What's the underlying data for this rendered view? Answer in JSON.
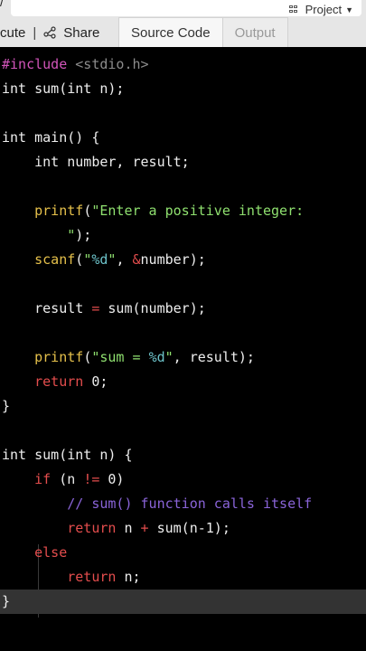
{
  "top": {
    "corner_glyph": "/",
    "project_label": "Project"
  },
  "toolbar": {
    "execute_label": "cute",
    "separator": "|",
    "share_label": "Share"
  },
  "tabs": [
    {
      "label": "Source Code",
      "active": true
    },
    {
      "label": "Output",
      "active": false
    }
  ],
  "code_lines": [
    [
      [
        "pp",
        "#include "
      ],
      [
        "hd",
        "<stdio.h>"
      ]
    ],
    [
      [
        "txt",
        "int sum(int n);"
      ]
    ],
    [],
    [
      [
        "txt",
        "int main() {"
      ]
    ],
    [
      [
        "txt",
        "    int number, result;"
      ]
    ],
    [],
    [
      [
        "txt",
        "    "
      ],
      [
        "fn",
        "printf"
      ],
      [
        "txt",
        "("
      ],
      [
        "str",
        "\"Enter a positive integer:"
      ]
    ],
    [
      [
        "str",
        "        \""
      ],
      [
        "txt",
        ");"
      ]
    ],
    [
      [
        "txt",
        "    "
      ],
      [
        "fn",
        "scanf"
      ],
      [
        "txt",
        "("
      ],
      [
        "str",
        "\""
      ],
      [
        "fmt",
        "%d"
      ],
      [
        "str",
        "\""
      ],
      [
        "txt",
        ", "
      ],
      [
        "op",
        "&"
      ],
      [
        "txt",
        "number);"
      ]
    ],
    [],
    [
      [
        "txt",
        "    result "
      ],
      [
        "op",
        "="
      ],
      [
        "txt",
        " sum(number);"
      ]
    ],
    [],
    [
      [
        "txt",
        "    "
      ],
      [
        "fn",
        "printf"
      ],
      [
        "txt",
        "("
      ],
      [
        "str",
        "\"sum = "
      ],
      [
        "fmt",
        "%d"
      ],
      [
        "str",
        "\""
      ],
      [
        "txt",
        ", result);"
      ]
    ],
    [
      [
        "txt",
        "    "
      ],
      [
        "kw",
        "return"
      ],
      [
        "txt",
        " 0;"
      ]
    ],
    [
      [
        "txt",
        "}"
      ]
    ],
    [],
    [
      [
        "txt",
        "int sum(int n) {"
      ]
    ],
    [
      [
        "txt",
        "    "
      ],
      [
        "kw",
        "if"
      ],
      [
        "txt",
        " (n "
      ],
      [
        "op",
        "!="
      ],
      [
        "txt",
        " 0)"
      ]
    ],
    [
      [
        "txt",
        "        "
      ],
      [
        "cm",
        "// sum() function calls itself"
      ]
    ],
    [
      [
        "txt",
        "        "
      ],
      [
        "kw",
        "return"
      ],
      [
        "txt",
        " n "
      ],
      [
        "op",
        "+"
      ],
      [
        "txt",
        " sum(n-1);"
      ]
    ],
    [
      [
        "txt",
        "    "
      ],
      [
        "kw",
        "else"
      ]
    ],
    [
      [
        "txt",
        "        "
      ],
      [
        "kw",
        "return"
      ],
      [
        "txt",
        " n;"
      ]
    ],
    [
      [
        "txt",
        "}"
      ]
    ]
  ],
  "active_line_index": 22,
  "colors": {
    "editor_bg": "#000000",
    "keyword": "#e34d4d",
    "function": "#e5c04b",
    "string": "#8fe06f",
    "comment": "#8a64d9",
    "preprocessor": "#d255ba"
  }
}
